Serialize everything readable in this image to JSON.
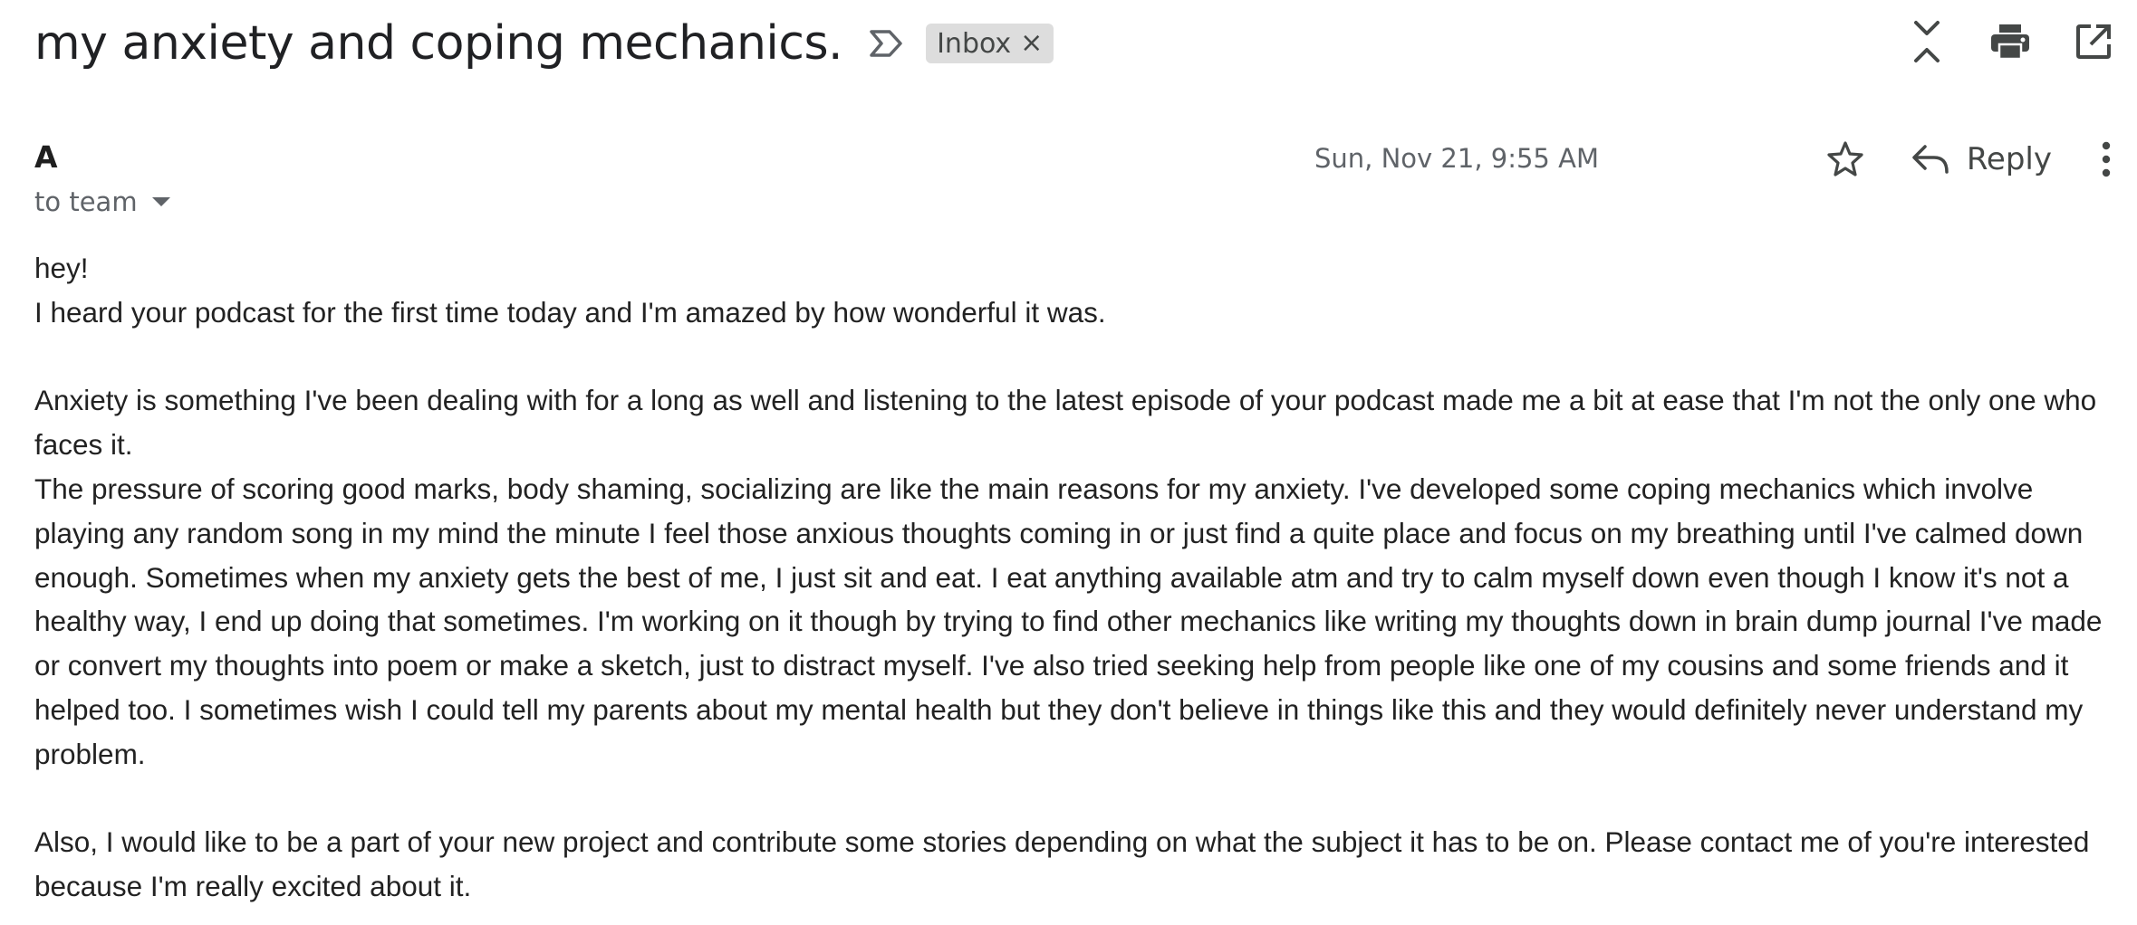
{
  "subject": "my anxiety and coping mechanics.",
  "label": {
    "name": "Inbox",
    "remove_glyph": "×"
  },
  "toolbar_icons": [
    "collapse-all-icon",
    "print-icon",
    "open-in-new-window-icon"
  ],
  "message": {
    "sender": "A",
    "recipients": "to team",
    "date": "Sun, Nov 21, 9:55 AM",
    "reply_label": "Reply"
  },
  "body": {
    "greeting": "hey!",
    "p1": "I heard your podcast for the first time today and I'm amazed by how wonderful it was.",
    "p2": "Anxiety is something I've been dealing with for a long as well and listening to the latest episode of your podcast made me a bit at ease that I'm not the only one who faces it.",
    "p3": "The pressure of scoring good marks, body shaming, socializing are like the main reasons for my anxiety. I've developed some coping mechanics which involve playing any random song in my mind the minute I feel those anxious thoughts coming in or just find a quite place and focus on my breathing until I've calmed down enough. Sometimes when my anxiety gets the best of me, I just sit and eat. I eat anything available atm and try to calm myself down even though I know it's not a healthy way, I end up doing that sometimes. I'm working on it though by trying to find other mechanics like writing my thoughts down in brain dump journal I've made or convert my thoughts into poem or make a sketch, just to distract myself. I've also tried seeking help from people like one of my cousins and some friends and it helped too. I sometimes wish I could tell my parents about my mental health but they don't believe in things like this and they would definitely never understand my problem.",
    "p4": "Also, I would like to be a part of your new project and contribute some stories depending on what the subject it has to be on. Please contact me of you're interested because I'm really excited about it."
  },
  "colors": {
    "text": "#202124",
    "muted": "#5f6368",
    "chip_bg": "#dddddd",
    "icon": "#444746"
  }
}
